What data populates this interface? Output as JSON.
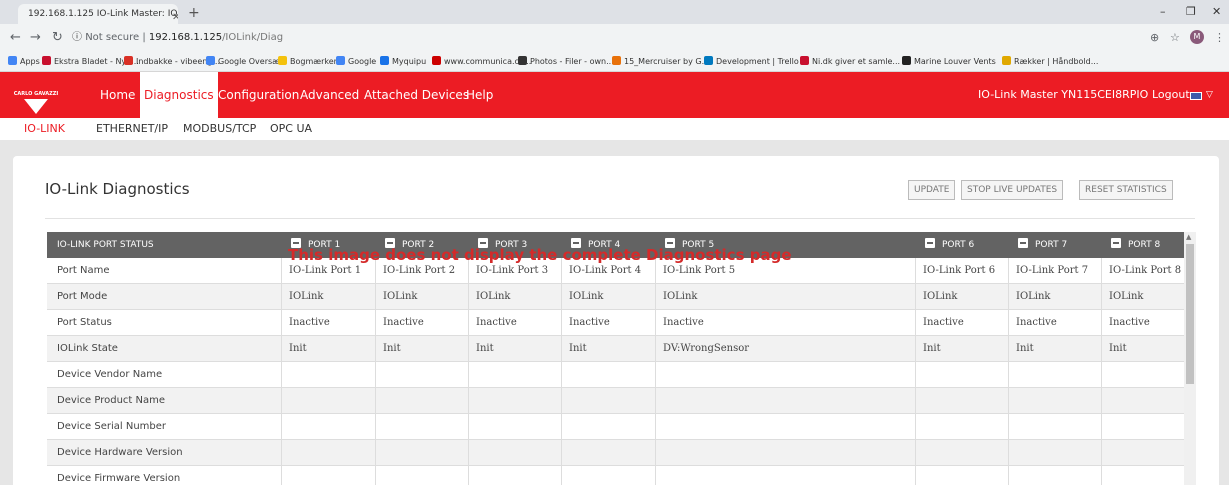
{
  "browser": {
    "tab_title": "192.168.1.125 IO-Link Master: IO",
    "url_secure": "Not secure",
    "url_host": "192.168.1.125",
    "url_path": "/IOLink/Diag",
    "bookmarks": [
      {
        "label": "Apps",
        "color": "#4285f4"
      },
      {
        "label": "Ekstra Bladet - Nyh...",
        "color": "#c8102e"
      },
      {
        "label": "Indbakke - vibeeng...",
        "color": "#d93025"
      },
      {
        "label": "Google Oversæt",
        "color": "#4285f4"
      },
      {
        "label": "Bogmærker",
        "color": "#f4c20d"
      },
      {
        "label": "Google",
        "color": "#4285f4"
      },
      {
        "label": "Myquipu",
        "color": "#1a73e8"
      },
      {
        "label": "www.communica.co...",
        "color": "#cc0000"
      },
      {
        "label": "Photos - Filer - own...",
        "color": "#333333"
      },
      {
        "label": "15_Mercruiser by G...",
        "color": "#e8710a"
      },
      {
        "label": "Development | Trello",
        "color": "#0079bf"
      },
      {
        "label": "Ni.dk giver et samle...",
        "color": "#c8102e"
      },
      {
        "label": "Marine Louver Vents",
        "color": "#222222"
      },
      {
        "label": "Rækker | Håndbold...",
        "color": "#e0a800"
      }
    ]
  },
  "app": {
    "logo_text": "CARLO GAVAZZI",
    "nav": [
      "Home",
      "Diagnostics",
      "Configuration",
      "Advanced",
      "Attached Devices",
      "Help"
    ],
    "device_name": "IO-Link Master YN115CEI8RPIO",
    "logout_label": "Logout"
  },
  "subnav": [
    "IO-LINK",
    "ETHERNET/IP",
    "MODBUS/TCP",
    "OPC UA"
  ],
  "page": {
    "title": "IO-Link Diagnostics",
    "buttons": {
      "update": "UPDATE",
      "stop_live": "STOP LIVE UPDATES",
      "reset_stats": "RESET STATISTICS"
    }
  },
  "table": {
    "header_label": "IO-LINK PORT STATUS",
    "ports": [
      "PORT 1",
      "PORT 2",
      "PORT 3",
      "PORT 4",
      "PORT 5",
      "PORT 6",
      "PORT 7",
      "PORT 8"
    ],
    "rows": [
      {
        "label": "Port Name",
        "values": [
          "IO-Link Port 1",
          "IO-Link Port 2",
          "IO-Link Port 3",
          "IO-Link Port 4",
          "IO-Link Port 5",
          "IO-Link Port 6",
          "IO-Link Port 7",
          "IO-Link Port 8"
        ]
      },
      {
        "label": "Port Mode",
        "values": [
          "IOLink",
          "IOLink",
          "IOLink",
          "IOLink",
          "IOLink",
          "IOLink",
          "IOLink",
          "IOLink"
        ]
      },
      {
        "label": "Port Status",
        "values": [
          "Inactive",
          "Inactive",
          "Inactive",
          "Inactive",
          "Inactive",
          "Inactive",
          "Inactive",
          "Inactive"
        ]
      },
      {
        "label": "IOLink State",
        "values": [
          "Init",
          "Init",
          "Init",
          "Init",
          "DV:WrongSensor",
          "Init",
          "Init",
          "Init"
        ]
      },
      {
        "label": "Device Vendor Name",
        "values": [
          "",
          "",
          "",
          "",
          "",
          "",
          "",
          ""
        ]
      },
      {
        "label": "Device Product Name",
        "values": [
          "",
          "",
          "",
          "",
          "",
          "",
          "",
          ""
        ]
      },
      {
        "label": "Device Serial Number",
        "values": [
          "",
          "",
          "",
          "",
          "",
          "",
          "",
          ""
        ]
      },
      {
        "label": "Device Hardware Version",
        "values": [
          "",
          "",
          "",
          "",
          "",
          "",
          "",
          ""
        ]
      },
      {
        "label": "Device Firmware Version",
        "values": [
          "",
          "",
          "",
          "",
          "",
          "",
          "",
          ""
        ]
      }
    ]
  },
  "overlay_note": "This image does not display the complete Diagnostics page",
  "colors": {
    "brand_red": "#ec1c24",
    "header_gray": "#636363"
  }
}
